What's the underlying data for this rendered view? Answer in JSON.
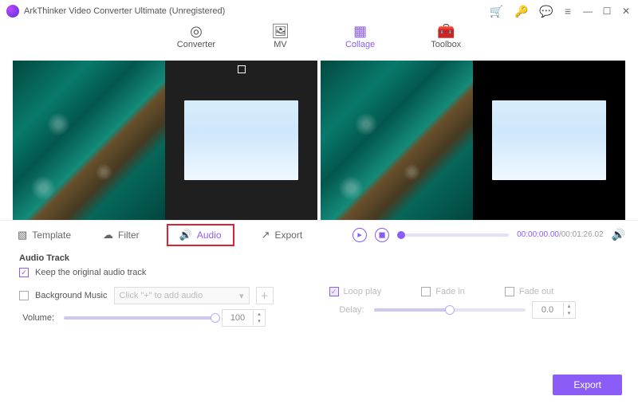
{
  "title": "ArkThinker Video Converter Ultimate (Unregistered)",
  "nav": {
    "converter": "Converter",
    "mv": "MV",
    "collage": "Collage",
    "toolbox": "Toolbox"
  },
  "subtabs": {
    "template": "Template",
    "filter": "Filter",
    "audio": "Audio",
    "export": "Export"
  },
  "playback": {
    "current": "00:00:00.00",
    "total": "00:01:26.02"
  },
  "audio": {
    "section_title": "Audio Track",
    "keep_original": "Keep the original audio track",
    "bg_music_label": "Background Music",
    "bg_music_placeholder": "Click \"+\" to add audio",
    "loop_play": "Loop play",
    "fade_in": "Fade in",
    "fade_out": "Fade out",
    "volume_label": "Volume:",
    "volume_value": "100",
    "delay_label": "Delay:",
    "delay_value": "0.0"
  },
  "footer": {
    "export": "Export"
  }
}
